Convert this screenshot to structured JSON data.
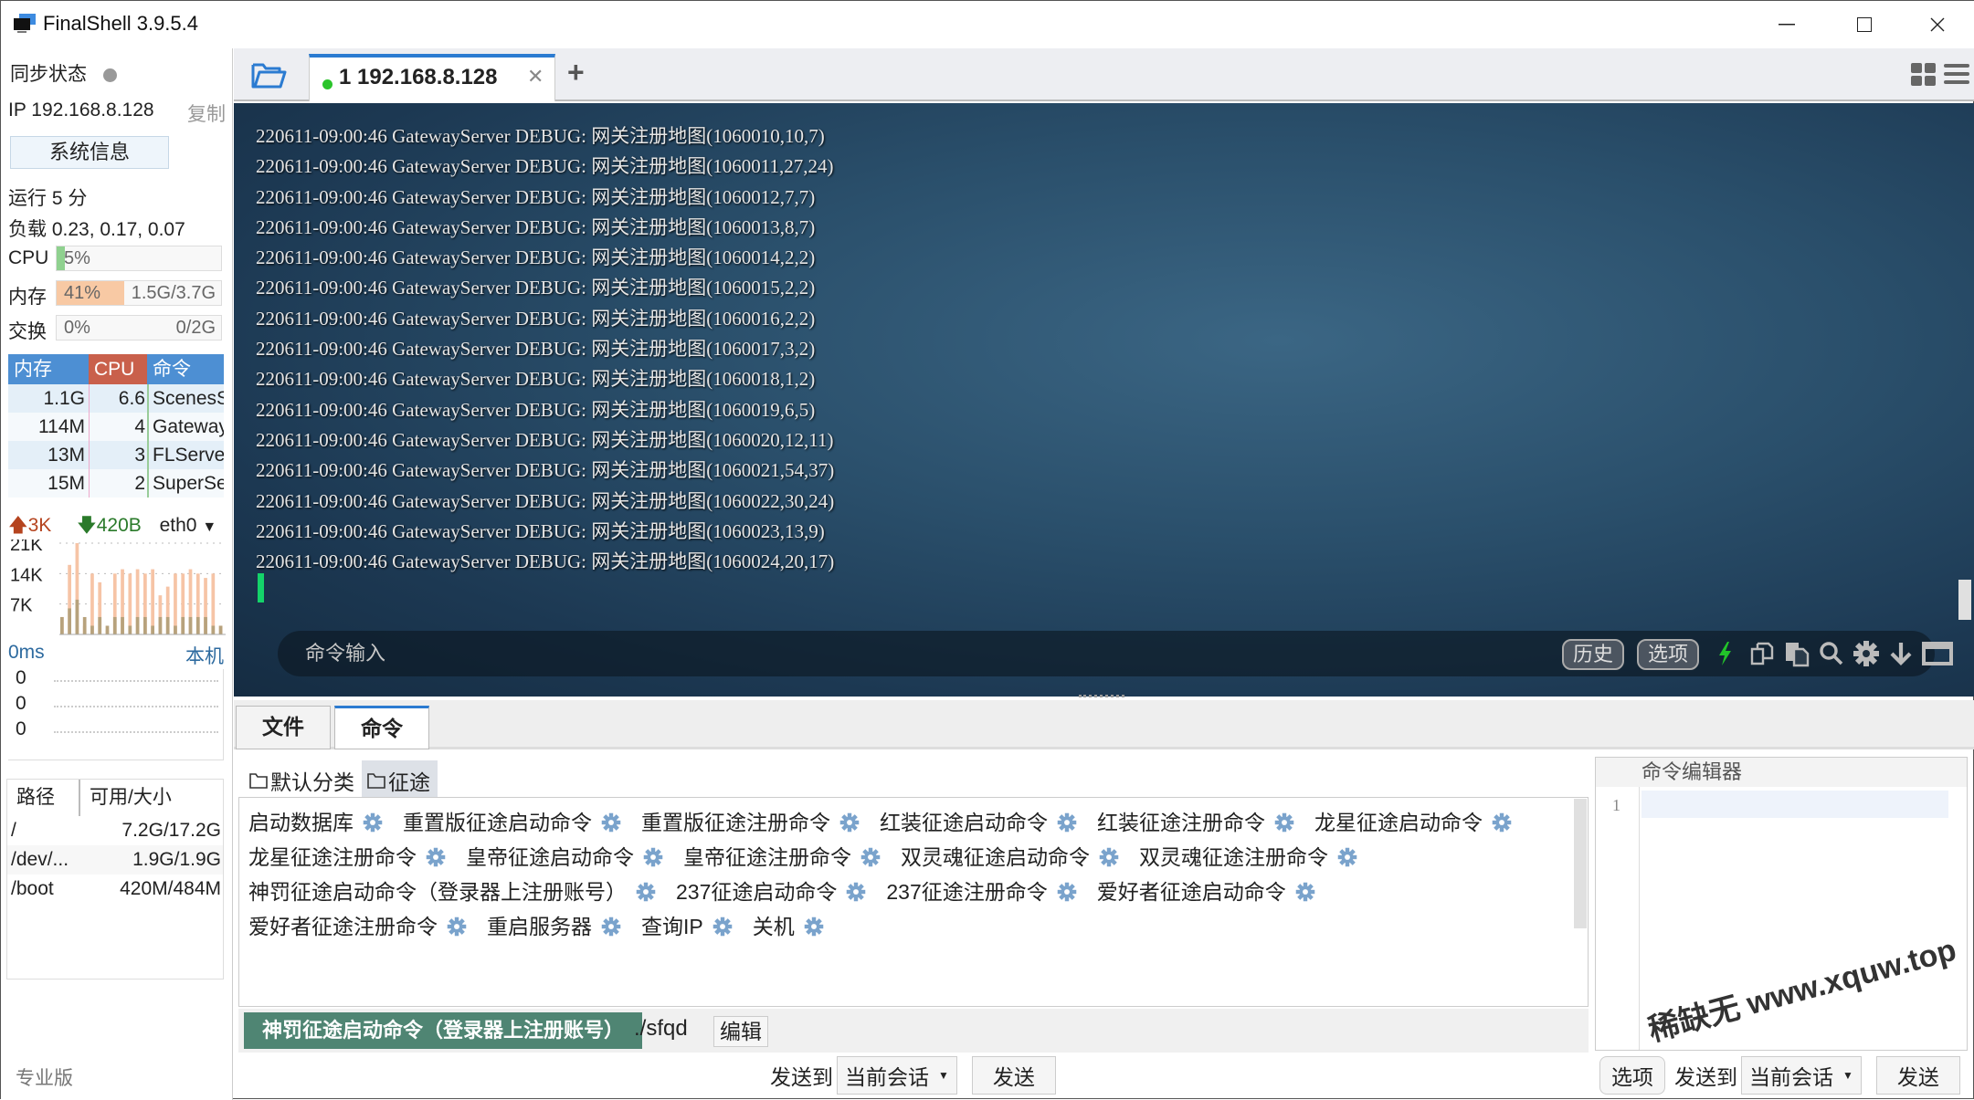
{
  "window": {
    "title": "FinalShell 3.9.5.4",
    "controls": [
      "minimize",
      "maximize",
      "close"
    ]
  },
  "sidebar": {
    "sync_label": "同步状态",
    "ip_label": "IP 192.168.8.128",
    "copy_label": "复制",
    "sysinfo_button": "系统信息",
    "uptime": "运行 5 分",
    "load": "负载 0.23, 0.17, 0.07",
    "cpu": {
      "label": "CPU",
      "value": "5%",
      "percent": 5
    },
    "memory": {
      "label": "内存",
      "value": "41%",
      "detail": "1.5G/3.7G",
      "percent": 41
    },
    "swap": {
      "label": "交换",
      "value": "0%",
      "detail": "0/2G",
      "percent": 0
    },
    "process_table": {
      "headers": [
        "内存",
        "CPU",
        "命令"
      ],
      "rows": [
        {
          "mem": "1.1G",
          "cpu": "6.6",
          "cmd": "ScenesServer"
        },
        {
          "mem": "114M",
          "cpu": "4",
          "cmd": "GatewayServer"
        },
        {
          "mem": "13M",
          "cpu": "3",
          "cmd": "FLServer"
        },
        {
          "mem": "15M",
          "cpu": "2",
          "cmd": "SuperServer"
        }
      ]
    },
    "network": {
      "upload": "3K",
      "download": "420B",
      "interface": "eth0",
      "axis_labels": [
        "21K",
        "14K",
        "7K"
      ],
      "upload_series": [
        4,
        16,
        21,
        2,
        14,
        12,
        1,
        14,
        15,
        14,
        15,
        14,
        15,
        9,
        11,
        14,
        14,
        15,
        14,
        13,
        14,
        2
      ],
      "download_series": [
        2,
        3,
        4,
        2,
        1,
        2,
        1,
        2,
        2,
        1,
        2,
        2,
        1,
        2,
        2,
        1,
        2,
        2,
        2,
        2,
        1,
        1
      ]
    },
    "ping": {
      "latency": "0ms",
      "host": "本机",
      "values": [
        "0",
        "0",
        "0"
      ]
    },
    "disk": {
      "headers": [
        "路径",
        "可用/大小"
      ],
      "rows": [
        {
          "path": "/",
          "usage": "7.2G/17.2G"
        },
        {
          "path": "/dev/...",
          "usage": "1.9G/1.9G"
        },
        {
          "path": "/boot",
          "usage": "420M/484M"
        }
      ]
    },
    "edition": "专业版"
  },
  "tabs": {
    "items": [
      {
        "label": "1 192.168.8.128",
        "status": "connected"
      }
    ],
    "new_tab": "+"
  },
  "terminal": {
    "lines": [
      "220611-09:00:46 GatewayServer DEBUG: 网关注册地图(1060010,10,7)",
      "220611-09:00:46 GatewayServer DEBUG: 网关注册地图(1060011,27,24)",
      "220611-09:00:46 GatewayServer DEBUG: 网关注册地图(1060012,7,7)",
      "220611-09:00:46 GatewayServer DEBUG: 网关注册地图(1060013,8,7)",
      "220611-09:00:46 GatewayServer DEBUG: 网关注册地图(1060014,2,2)",
      "220611-09:00:46 GatewayServer DEBUG: 网关注册地图(1060015,2,2)",
      "220611-09:00:46 GatewayServer DEBUG: 网关注册地图(1060016,2,2)",
      "220611-09:00:46 GatewayServer DEBUG: 网关注册地图(1060017,3,2)",
      "220611-09:00:46 GatewayServer DEBUG: 网关注册地图(1060018,1,2)",
      "220611-09:00:46 GatewayServer DEBUG: 网关注册地图(1060019,6,5)",
      "220611-09:00:46 GatewayServer DEBUG: 网关注册地图(1060020,12,11)",
      "220611-09:00:46 GatewayServer DEBUG: 网关注册地图(1060021,54,37)",
      "220611-09:00:46 GatewayServer DEBUG: 网关注册地图(1060022,30,24)",
      "220611-09:00:46 GatewayServer DEBUG: 网关注册地图(1060023,13,9)",
      "220611-09:00:46 GatewayServer DEBUG: 网关注册地图(1060024,20,17)"
    ],
    "command_placeholder": "命令输入",
    "history_button": "历史",
    "options_button": "选项",
    "toolbar_icons": [
      "lightning-icon",
      "copy-icon",
      "paste-icon",
      "search-icon",
      "gear-icon",
      "scroll-down-icon",
      "maximize-icon"
    ]
  },
  "bottom": {
    "tabs": [
      "文件",
      "命令"
    ],
    "active_tab": "命令",
    "categories": [
      "默认分类",
      "征途"
    ],
    "active_category": "征途",
    "commands": [
      "启动数据库",
      "重置版征途启动命令",
      "重置版征途注册命令",
      "红装征途启动命令",
      "红装征途注册命令",
      "龙星征途启动命令",
      "龙星征途注册命令",
      "皇帝征途启动命令",
      "皇帝征途注册命令",
      "双灵魂征途启动命令",
      "双灵魂征途注册命令",
      "神罚征途启动命令（登录器上注册账号）",
      "237征途启动命令",
      "237征途注册命令",
      "爱好者征途启动命令",
      "爱好者征途注册命令",
      "重启服务器",
      "查询IP",
      "关机"
    ],
    "selected": {
      "name": "神罚征途启动命令（登录器上注册账号）",
      "command": "./sfqd",
      "edit_label": "编辑"
    },
    "send_to_label": "发送到",
    "send_target": "当前会话",
    "send_button": "发送"
  },
  "editor": {
    "title": "命令编辑器",
    "line_numbers": [
      "1"
    ],
    "options_button": "选项",
    "send_to_label": "发送到",
    "send_target": "当前会话",
    "send_button": "发送"
  },
  "watermark": "稀缺无 www.xquw.top",
  "colors": {
    "accent_blue": "#2b7bd1",
    "proc_header_blue": "#4d8fd3",
    "proc_header_cpu": "#c9604b",
    "mem_fill": "#f8c9a4",
    "cpu_fill": "#8fd18f",
    "selected_command": "#4f8573",
    "gear_blue": "#7aa3cc",
    "cursor_green": "#14d36a"
  }
}
